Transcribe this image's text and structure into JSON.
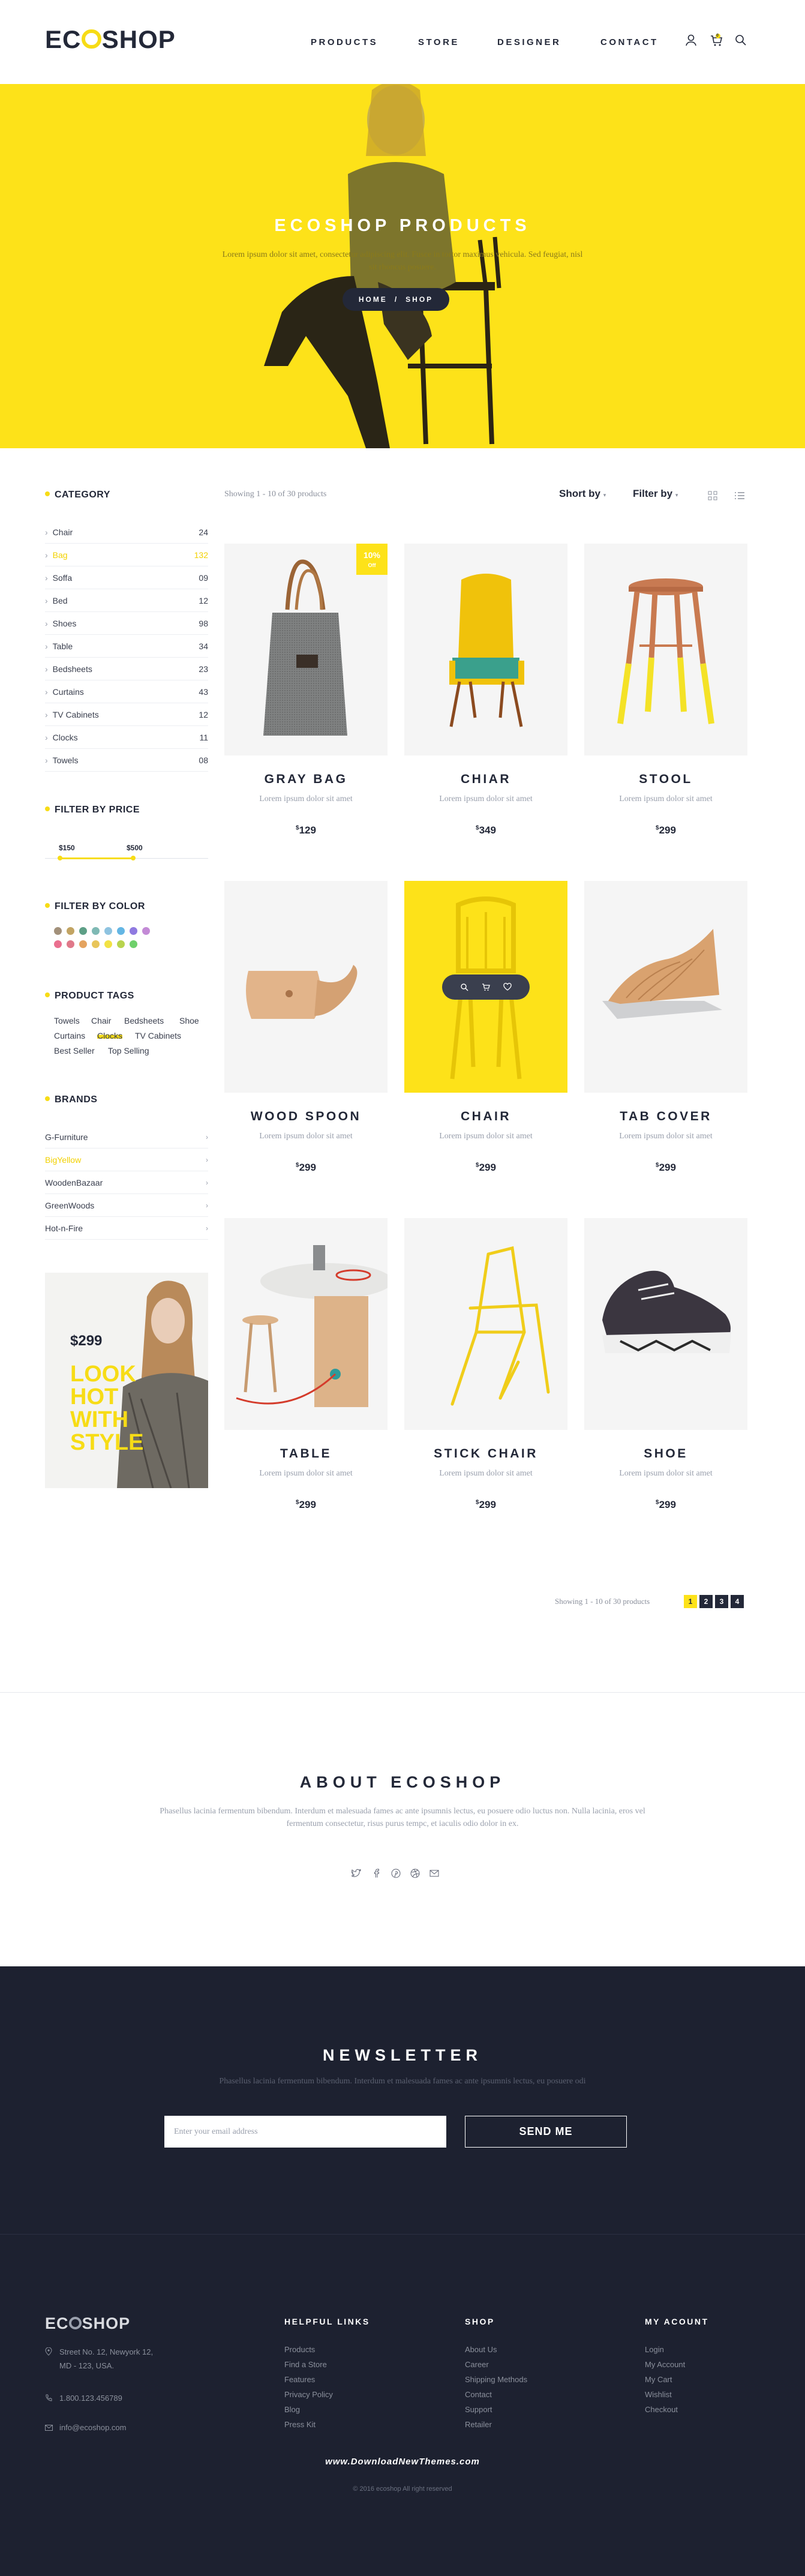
{
  "header": {
    "logo": "ECOSHOP",
    "nav": [
      "PRODUCTS",
      "STORE",
      "DESIGNER",
      "CONTACT"
    ],
    "active_nav": "PRODUCTS",
    "cart_count": "0"
  },
  "hero": {
    "title": "ECOSHOP PRODUCTS",
    "subtitle": "Lorem ipsum dolor sit amet, consectetur adipiscing elit. Fusce in tortor maximus vehicula. Sed feugiat, nisl sit rhoncus posuere.",
    "breadcrumb": [
      "HOME",
      "/",
      "SHOP"
    ]
  },
  "sidebar": {
    "category_title": "CATEGORY",
    "categories": [
      {
        "name": "Chair",
        "count": "24"
      },
      {
        "name": "Bag",
        "count": "132"
      },
      {
        "name": "Soffa",
        "count": "09"
      },
      {
        "name": "Bed",
        "count": "12"
      },
      {
        "name": "Shoes",
        "count": "98"
      },
      {
        "name": "Table",
        "count": "34"
      },
      {
        "name": "Bedsheets",
        "count": "23"
      },
      {
        "name": "Curtains",
        "count": "43"
      },
      {
        "name": "TV Cabinets",
        "count": "12"
      },
      {
        "name": "Clocks",
        "count": "11"
      },
      {
        "name": "Towels",
        "count": "08"
      }
    ],
    "active_category": "Bag",
    "price_title": "FILTER BY PRICE",
    "price_min": "$150",
    "price_max": "$500",
    "color_title": "FILTER BY COLOR",
    "colors": [
      "#a2907a",
      "#c2a463",
      "#5d9f86",
      "#7fb9b4",
      "#8ec3e0",
      "#64b6e4",
      "#8f7ae0",
      "#c38ad6",
      "#ea6f8f",
      "#e0798a",
      "#e4a35f",
      "#e8c55a",
      "#f2e244",
      "#b8d44e",
      "#6ed06b"
    ],
    "tags_title": "PRODUCT TAGS",
    "tags": [
      "Towels",
      "Chair",
      "Bedsheets",
      "Shoe",
      "Curtains",
      "Clocks",
      "TV Cabinets",
      "Best Seller",
      "Top Selling"
    ],
    "active_tag": "Clocks",
    "brands_title": "BRANDS",
    "brands": [
      "G-Furniture",
      "BigYellow",
      "WoodenBazaar",
      "GreenWoods",
      "Hot-n-Fire"
    ],
    "active_brand": "BigYellow"
  },
  "promo": {
    "price": "$299",
    "headline_lines": [
      "LOOK",
      "HOT",
      "WITH",
      "STYLE"
    ]
  },
  "toolbar": {
    "showing": "Showing 1 - 10 of 30 products",
    "sort_label": "Short by",
    "filter_label": "Filter by"
  },
  "products": [
    {
      "name": "GRAY BAG",
      "desc": "Lorem ipsum dolor sit amet",
      "price": "129",
      "badge": "10%\nOff"
    },
    {
      "name": "CHIAR",
      "desc": "Lorem ipsum dolor sit amet",
      "price": "349"
    },
    {
      "name": "STOOL",
      "desc": "Lorem ipsum dolor sit amet",
      "price": "299"
    },
    {
      "name": "WOOD SPOON",
      "desc": "Lorem ipsum dolor sit amet",
      "price": "299"
    },
    {
      "name": "CHAIR",
      "desc": "Lorem ipsum dolor sit amet",
      "price": "299"
    },
    {
      "name": "TAB COVER",
      "desc": "Lorem ipsum dolor sit amet",
      "price": "299"
    },
    {
      "name": "TABLE",
      "desc": "Lorem ipsum dolor sit amet",
      "price": "299"
    },
    {
      "name": "STICK CHAIR",
      "desc": "Lorem ipsum dolor sit amet",
      "price": "299"
    },
    {
      "name": "SHOE",
      "desc": "Lorem ipsum dolor sit amet",
      "price": "299"
    }
  ],
  "currency_symbol": "$",
  "pagination": {
    "showing": "Showing 1 - 10 of 30 products",
    "pages": [
      "1",
      "2",
      "3",
      "4"
    ],
    "active_page": "1"
  },
  "about": {
    "title": "ABOUT ECOSHOP",
    "text": "Phasellus lacinia fermentum bibendum. Interdum et malesuada fames ac ante ipsumnis lectus, eu posuere odio luctus non. Nulla lacinia, eros vel fermentum consectetur, risus purus tempc, et iaculis odio dolor in ex.",
    "social_icons": [
      "twitter-icon",
      "facebook-icon",
      "pinterest-icon",
      "dribbble-icon",
      "mail-icon"
    ]
  },
  "newsletter": {
    "title": "NEWSLETTER",
    "subtitle": "Phasellus lacinia fermentum bibendum. Interdum et malesuada fames ac ante ipsumnis lectus, eu posuere odi",
    "placeholder": "Enter your email address",
    "button": "SEND ME"
  },
  "footer": {
    "logo": "ECOSHOP",
    "address_lines": [
      "Street No. 12, Newyork 12,",
      "MD - 123, USA."
    ],
    "phone": "1.800.123.456789",
    "email": "info@ecoshop.com",
    "helpful_title": "HELPFUL LINKS",
    "helpful_links": [
      "Products",
      "Find a Store",
      "Features",
      "Privacy Policy",
      "Blog",
      "Press Kit"
    ],
    "shop_title": "SHOP",
    "shop_links": [
      "About Us",
      "Career",
      "Shipping Methods",
      "Contact",
      "Support",
      "Retailer"
    ],
    "account_title": "MY ACOUNT",
    "account_links": [
      "Login",
      "My Account",
      "My Cart",
      "Wishlist",
      "Checkout"
    ],
    "watermark": "www.DownloadNewThemes.com",
    "copyright": "© 2016 ecoshop All right reserved"
  }
}
